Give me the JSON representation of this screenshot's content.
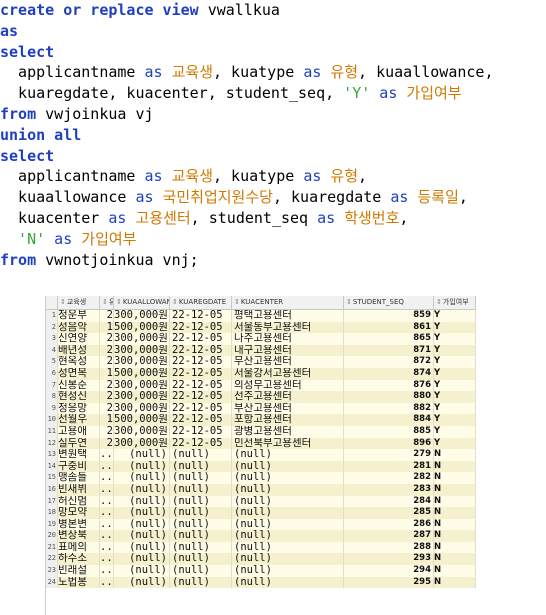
{
  "editor": {
    "lines": [
      [
        {
          "t": "create or replace view ",
          "c": "kw"
        },
        {
          "t": "vwallkua",
          "c": "id"
        }
      ],
      [
        {
          "t": "as",
          "c": "kw"
        }
      ],
      [
        {
          "t": "select",
          "c": "kw"
        }
      ],
      [
        {
          "t": "  applicantname ",
          "c": "id"
        },
        {
          "t": "as",
          "c": "hl"
        },
        {
          "t": " 교육생",
          "c": "kr"
        },
        {
          "t": ", kuatype ",
          "c": "id"
        },
        {
          "t": "as",
          "c": "hl"
        },
        {
          "t": " 유형",
          "c": "kr"
        },
        {
          "t": ", kuaallowance,",
          "c": "id"
        }
      ],
      [
        {
          "t": "  kuaregdate, kuacenter, student_seq, ",
          "c": "id"
        },
        {
          "t": "'Y'",
          "c": "str"
        },
        {
          "t": " as",
          "c": "hl"
        },
        {
          "t": " 가입여부",
          "c": "kr"
        }
      ],
      [
        {
          "t": "from",
          "c": "kw"
        },
        {
          "t": " vwjoinkua vj",
          "c": "id"
        }
      ],
      [
        {
          "t": "union all",
          "c": "kw"
        }
      ],
      [
        {
          "t": "select",
          "c": "kw"
        }
      ],
      [
        {
          "t": "  applicantname ",
          "c": "id"
        },
        {
          "t": "as",
          "c": "hl"
        },
        {
          "t": " 교육생",
          "c": "kr"
        },
        {
          "t": ", kuatype ",
          "c": "id"
        },
        {
          "t": "as",
          "c": "hl"
        },
        {
          "t": " 유형",
          "c": "kr"
        },
        {
          "t": ",",
          "c": "id"
        }
      ],
      [
        {
          "t": "  kuaallowance ",
          "c": "id"
        },
        {
          "t": "as",
          "c": "hl"
        },
        {
          "t": " 국민취업지원수당",
          "c": "kr"
        },
        {
          "t": ", kuaregdate ",
          "c": "id"
        },
        {
          "t": "as",
          "c": "hl"
        },
        {
          "t": " 등록일",
          "c": "kr"
        },
        {
          "t": ",",
          "c": "id"
        }
      ],
      [
        {
          "t": "  kuacenter ",
          "c": "id"
        },
        {
          "t": "as",
          "c": "hl"
        },
        {
          "t": " 고용센터",
          "c": "kr"
        },
        {
          "t": ", student_seq ",
          "c": "id"
        },
        {
          "t": "as",
          "c": "hl"
        },
        {
          "t": " 학생번호",
          "c": "kr"
        },
        {
          "t": ",",
          "c": "id"
        }
      ],
      [
        {
          "t": "  'N'",
          "c": "str"
        },
        {
          "t": " as",
          "c": "hl"
        },
        {
          "t": " 가입여부",
          "c": "kr"
        }
      ],
      [
        {
          "t": "from",
          "c": "kw"
        },
        {
          "t": " vwnotjoinkua vnj;",
          "c": "id"
        }
      ]
    ]
  },
  "grid": {
    "columns": [
      "",
      "교육생",
      "유형",
      "KUAALLOWANCE",
      "KUAREGDATE",
      "KUACENTER",
      "STUDENT_SEQ",
      "가입여부"
    ],
    "rows": [
      [
        "1",
        "정운부",
        "2",
        "300,000원",
        "22-12-05",
        "평택고용센터",
        "859",
        "Y"
      ],
      [
        "2",
        "성음악",
        "1",
        "500,000원",
        "22-12-05",
        "서울동부고용센터",
        "861",
        "Y"
      ],
      [
        "3",
        "신연양",
        "2",
        "300,000원",
        "22-12-05",
        "나주고용센터",
        "865",
        "Y"
      ],
      [
        "4",
        "배년성",
        "2",
        "300,000원",
        "22-12-05",
        "내구고용센터",
        "871",
        "Y"
      ],
      [
        "5",
        "현옥성",
        "2",
        "300,000원",
        "22-12-05",
        "무산고용센터",
        "872",
        "Y"
      ],
      [
        "6",
        "성면목",
        "1",
        "500,000원",
        "22-12-05",
        "서울강서고용센터",
        "874",
        "Y"
      ],
      [
        "7",
        "신봉순",
        "2",
        "300,000원",
        "22-12-05",
        "의성무고용센터",
        "876",
        "Y"
      ],
      [
        "8",
        "현성신",
        "2",
        "300,000원",
        "22-12-05",
        "선주고용센터",
        "880",
        "Y"
      ],
      [
        "9",
        "정응망",
        "2",
        "300,000원",
        "22-12-05",
        "부산고용센터",
        "882",
        "Y"
      ],
      [
        "10",
        "선월우",
        "1",
        "500,000원",
        "22-12-05",
        "포항고용센터",
        "884",
        "Y"
      ],
      [
        "11",
        "고용애",
        "2",
        "300,000원",
        "22-12-05",
        "광병고용센터",
        "885",
        "Y"
      ],
      [
        "12",
        "실두연",
        "2",
        "300,000원",
        "22-12-05",
        "민선북부고용센터",
        "896",
        "Y"
      ],
      [
        "13",
        "변원택",
        "...",
        "(null)",
        "(null)",
        "(null)",
        "279",
        "N"
      ],
      [
        "14",
        "구중비",
        "...",
        "(null)",
        "(null)",
        "(null)",
        "281",
        "N"
      ],
      [
        "15",
        "맹솜들",
        "...",
        "(null)",
        "(null)",
        "(null)",
        "282",
        "N"
      ],
      [
        "16",
        "빈새뷔",
        "...",
        "(null)",
        "(null)",
        "(null)",
        "283",
        "N"
      ],
      [
        "17",
        "허신멈",
        "...",
        "(null)",
        "(null)",
        "(null)",
        "284",
        "N"
      ],
      [
        "18",
        "망모약",
        "...",
        "(null)",
        "(null)",
        "(null)",
        "285",
        "N"
      ],
      [
        "19",
        "병본변",
        "...",
        "(null)",
        "(null)",
        "(null)",
        "286",
        "N"
      ],
      [
        "20",
        "변상북",
        "...",
        "(null)",
        "(null)",
        "(null)",
        "287",
        "N"
      ],
      [
        "21",
        "표메의",
        "...",
        "(null)",
        "(null)",
        "(null)",
        "288",
        "N"
      ],
      [
        "22",
        "하수소",
        "...",
        "(null)",
        "(null)",
        "(null)",
        "293",
        "N"
      ],
      [
        "23",
        "빈래설",
        "...",
        "(null)",
        "(null)",
        "(null)",
        "294",
        "N"
      ],
      [
        "24",
        "노법봉",
        "...",
        "(null)",
        "(null)",
        "(null)",
        "295",
        "N"
      ]
    ]
  }
}
